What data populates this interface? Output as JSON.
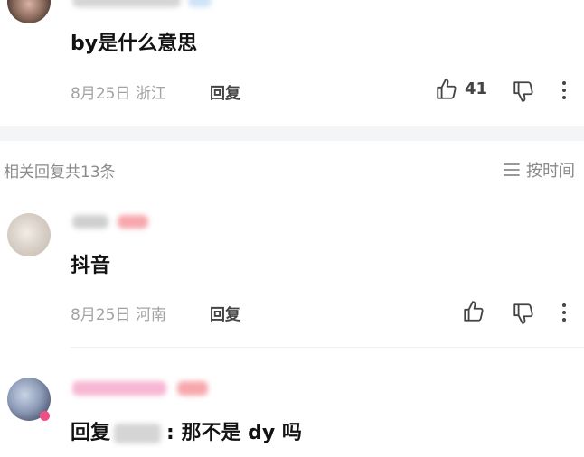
{
  "top_comment": {
    "text": "by是什么意思",
    "date": "8月25日 浙江",
    "reply_label": "回复",
    "like_count": "41",
    "icons": [
      "thumb-up-icon",
      "thumb-down-icon",
      "more-vertical-icon"
    ]
  },
  "replies_section": {
    "title": "相关回复共13条",
    "sort_label": "按时间",
    "sort_icon": "menu-lines-icon"
  },
  "replies": [
    {
      "text": "抖音",
      "date": "8月25日 河南",
      "reply_label": "回复"
    },
    {
      "prefix": "回复",
      "suffix": ": 那不是 dy 吗"
    }
  ],
  "colors": {
    "text_primary": "#121212",
    "text_secondary": "#a3a3a3",
    "section_bg": "#f4f5f6",
    "badge_pink": "#f04e85"
  }
}
